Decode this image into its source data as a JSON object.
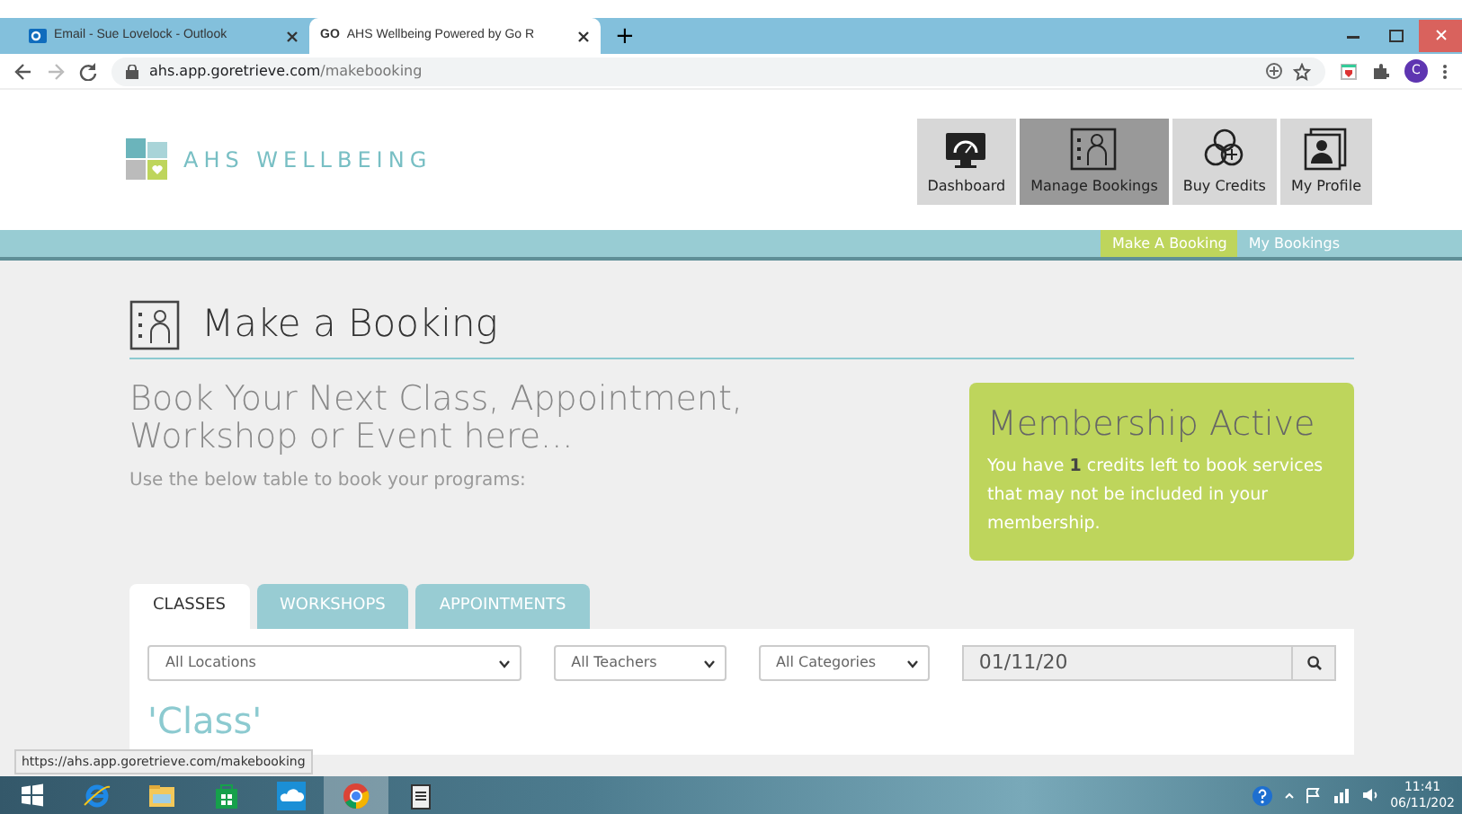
{
  "browser": {
    "tabs": [
      {
        "title": "Email - Sue Lovelock - Outlook",
        "selected": false
      },
      {
        "title": "AHS Wellbeing Powered by Go R",
        "selected": true
      }
    ],
    "favicon_text": "GO",
    "new_tab": "+",
    "url_host": "ahs.app.goretrieve.com",
    "url_path": "/makebooking",
    "profile": "C"
  },
  "site": {
    "logo": "AHS WELLBEING",
    "nav": [
      {
        "label": "Dashboard",
        "selected": false
      },
      {
        "label": "Manage Bookings",
        "selected": true
      },
      {
        "label": "Buy Credits",
        "selected": false
      },
      {
        "label": "My Profile",
        "selected": false
      }
    ],
    "subnav": [
      {
        "label": "Make A Booking",
        "selected": true
      },
      {
        "label": "My Bookings",
        "selected": false
      }
    ]
  },
  "page": {
    "title": "Make a Booking",
    "heading": "Book Your Next Class, Appointment, Workshop or Event here...",
    "intro": "Use the below table to book your programs:",
    "membership": {
      "title": "Membership Active",
      "text": "You have **1** credits left to book services that may not be included in your membership."
    },
    "tabs": [
      {
        "label": "CLASSES",
        "selected": true
      },
      {
        "label": "WORKSHOPS",
        "selected": false
      },
      {
        "label": "APPOINTMENTS",
        "selected": false
      }
    ],
    "filters": [
      {
        "value": "All Locations"
      },
      {
        "value": "All Teachers"
      },
      {
        "value": "All Categories"
      }
    ],
    "date": "01/11/20",
    "section": "'Class'"
  },
  "status_url": "https://ahs.app.goretrieve.com/makebooking",
  "taskbar": {
    "apps": [
      {
        "selected": false
      },
      {
        "selected": false
      },
      {
        "selected": false
      },
      {
        "selected": false
      },
      {
        "selected": false
      },
      {
        "selected": true
      },
      {
        "selected": false
      }
    ],
    "time": "11:41",
    "date": "06/11/202"
  }
}
